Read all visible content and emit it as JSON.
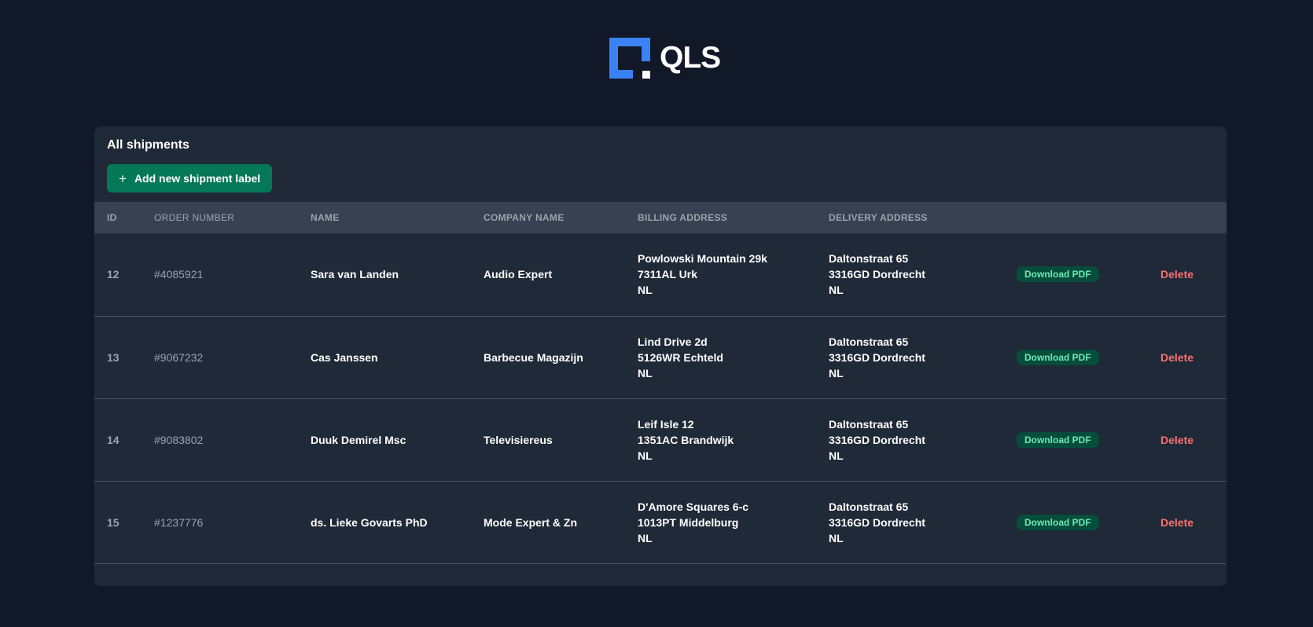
{
  "logo": {
    "text": "QLS",
    "brand_color": "#3b82f6"
  },
  "card": {
    "title": "All shipments",
    "add_button": {
      "icon": "plus-icon",
      "label": "Add new shipment label"
    }
  },
  "table": {
    "headers": [
      "ID",
      "ORDER NUMBER",
      "NAME",
      "COMPANY NAME",
      "BILLING ADDRESS",
      "DELIVERY ADDRESS",
      "",
      ""
    ],
    "rows": [
      {
        "id": "12",
        "order": "#4085921",
        "name": "Sara van Landen",
        "company": "Audio Expert",
        "billing": [
          "Powlowski Mountain 29k",
          "7311AL Urk",
          "NL"
        ],
        "delivery": [
          "Daltonstraat 65",
          "3316GD Dordrecht",
          "NL"
        ],
        "pdf_label": "Download PDF",
        "delete_label": "Delete"
      },
      {
        "id": "13",
        "order": "#9067232",
        "name": "Cas Janssen",
        "company": "Barbecue Magazijn",
        "billing": [
          "Lind Drive 2d",
          "5126WR Echteld",
          "NL"
        ],
        "delivery": [
          "Daltonstraat 65",
          "3316GD Dordrecht",
          "NL"
        ],
        "pdf_label": "Download PDF",
        "delete_label": "Delete"
      },
      {
        "id": "14",
        "order": "#9083802",
        "name": "Duuk Demirel Msc",
        "company": "Televisiereus",
        "billing": [
          "Leif Isle 12",
          "1351AC Brandwijk",
          "NL"
        ],
        "delivery": [
          "Daltonstraat 65",
          "3316GD Dordrecht",
          "NL"
        ],
        "pdf_label": "Download PDF",
        "delete_label": "Delete"
      },
      {
        "id": "15",
        "order": "#1237776",
        "name": "ds. Lieke Govarts PhD",
        "company": "Mode Expert & Zn",
        "billing": [
          "D'Amore Squares 6-c",
          "1013PT Middelburg",
          "NL"
        ],
        "delivery": [
          "Daltonstraat 65",
          "3316GD Dordrecht",
          "NL"
        ],
        "pdf_label": "Download PDF",
        "delete_label": "Delete"
      }
    ]
  }
}
